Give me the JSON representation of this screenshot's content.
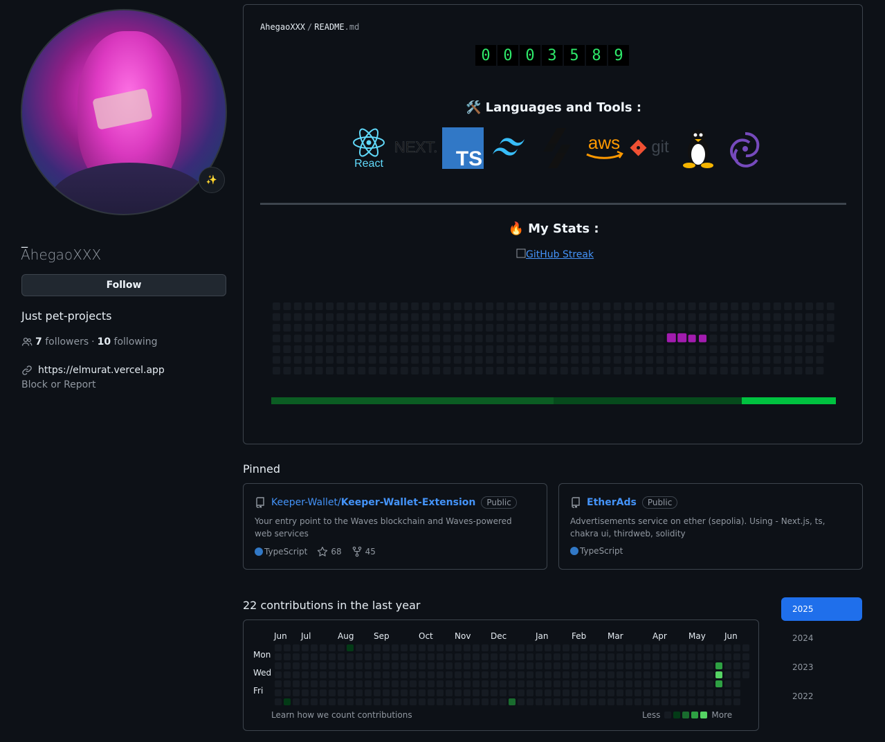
{
  "profile": {
    "status_emoji": "✨",
    "display_name": "_",
    "username": "AhegaoXXX",
    "follow_label": "Follow",
    "bio": "Just pet-projects",
    "followers_count": "7",
    "followers_label": "followers",
    "dot": "·",
    "following_count": "10",
    "following_label": "following",
    "website": "https://elmurat.vercel.app",
    "block_label": "Block or Report"
  },
  "readme": {
    "owner": "AhegaoXXX",
    "separator": "/",
    "file": "README",
    "ext": ".md",
    "counter_digits": [
      "0",
      "0",
      "0",
      "3",
      "5",
      "8",
      "9"
    ],
    "tools_title": "🛠️ Languages and Tools :",
    "tools": [
      {
        "name": "react-icon",
        "label": "React"
      },
      {
        "name": "nextjs-icon",
        "label": "NEXT."
      },
      {
        "name": "typescript-icon",
        "label": "TS"
      },
      {
        "name": "tailwind-icon",
        "label": ""
      },
      {
        "name": "solidity-icon",
        "label": ""
      },
      {
        "name": "aws-icon",
        "label": "aws"
      },
      {
        "name": "git-icon",
        "label": "git"
      },
      {
        "name": "linux-icon",
        "label": ""
      },
      {
        "name": "redux-icon",
        "label": ""
      }
    ],
    "stats_title": "🔥 My Stats :",
    "streak_alt": "GitHub Streak"
  },
  "pinned": {
    "title": "Pinned",
    "repos": [
      {
        "owner": "Keeper-Wallet/",
        "name": "Keeper-Wallet-Extension",
        "visibility": "Public",
        "description": "Your entry point to the Waves blockchain and Waves-powered web services",
        "language": "TypeScript",
        "stars": "68",
        "forks": "45"
      },
      {
        "owner": "",
        "name": "EtherAds",
        "visibility": "Public",
        "description": "Advertisements service on ether (sepolia). Using - Next.js, ts, chakra ui, thirdweb, solidity",
        "language": "TypeScript"
      }
    ]
  },
  "contributions": {
    "title": "22 contributions in the last year",
    "months": [
      "Jun",
      "Jul",
      "Aug",
      "Sep",
      "Oct",
      "Nov",
      "Dec",
      "Jan",
      "Feb",
      "Mar",
      "Apr",
      "May",
      "Jun"
    ],
    "days": [
      "Mon",
      "Wed",
      "Fri"
    ],
    "learn_label": "Learn how we count contributions",
    "less_label": "Less",
    "more_label": "More",
    "years": [
      "2025",
      "2024",
      "2023",
      "2022"
    ],
    "active_year": "2025"
  },
  "colors": {
    "accent": "#1f6feb",
    "link": "#4493f8",
    "green_levels": [
      "#161b22",
      "#033a16",
      "#196c2e",
      "#2ea043",
      "#56d364"
    ],
    "magenta": "#a21caf"
  }
}
